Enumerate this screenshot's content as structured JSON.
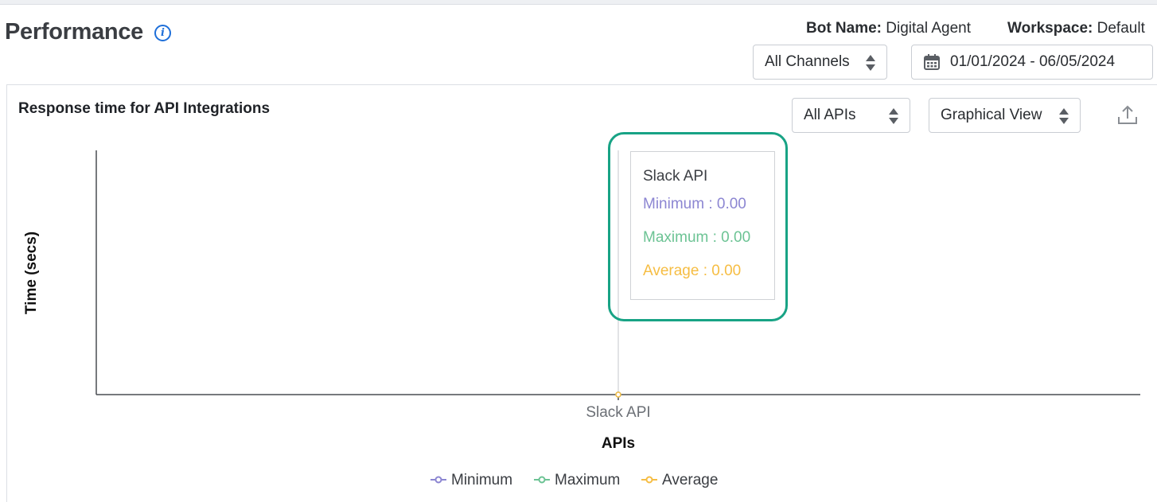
{
  "header": {
    "title": "Performance",
    "bot_label": "Bot Name:",
    "bot_value": "Digital Agent",
    "workspace_label": "Workspace:",
    "workspace_value": "Default",
    "channels_select": "All Channels",
    "date_range": "01/01/2024 - 06/05/2024"
  },
  "card": {
    "title": "Response time for API Integrations",
    "apis_select": "All APIs",
    "view_select": "Graphical View"
  },
  "tooltip": {
    "title": "Slack API",
    "min_label": "Minimum : 0.00",
    "max_label": "Maximum : 0.00",
    "avg_label": "Average : 0.00"
  },
  "colors": {
    "minimum": "#8c86d2",
    "maximum": "#6cc394",
    "average": "#f6bd43",
    "highlight": "#18a385"
  },
  "icons": {
    "info": "info-icon",
    "calendar": "calendar-icon",
    "export": "export-icon"
  },
  "chart_data": {
    "type": "line",
    "categories": [
      "Slack API"
    ],
    "series": [
      {
        "name": "Minimum",
        "values": [
          0.0
        ],
        "color": "#8c86d2"
      },
      {
        "name": "Maximum",
        "values": [
          0.0
        ],
        "color": "#6cc394"
      },
      {
        "name": "Average",
        "values": [
          0.0
        ],
        "color": "#f6bd43"
      }
    ],
    "xlabel": "APIs",
    "ylabel": "Time (secs)",
    "legend_position": "bottom",
    "grid": false
  }
}
